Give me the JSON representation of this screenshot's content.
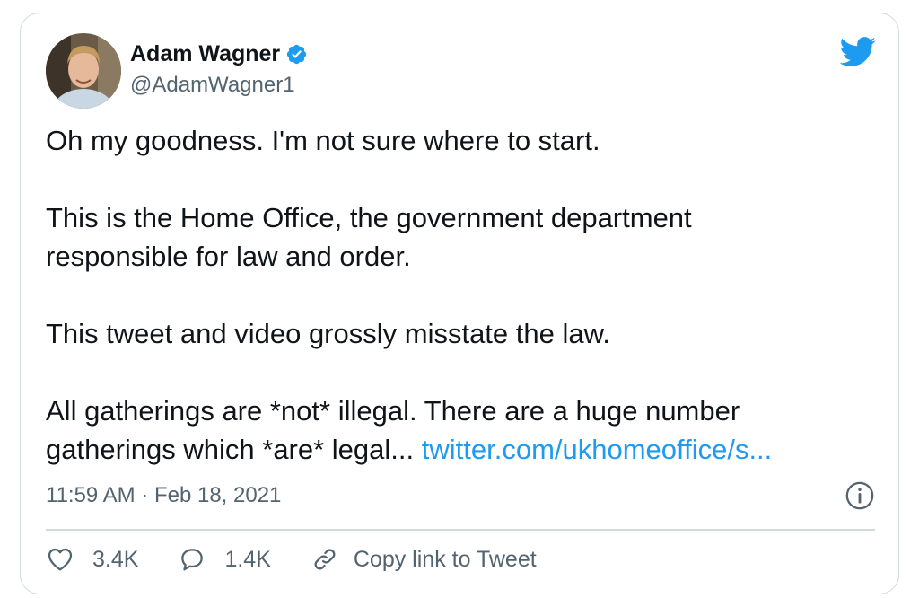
{
  "author": {
    "display_name": "Adam Wagner",
    "handle": "@AdamWagner1",
    "verified": true
  },
  "tweet": {
    "lines": [
      "Oh my goodness. I'm not sure where to start.",
      "",
      "This is the Home Office, the government department",
      "responsible for law and order.",
      "",
      "This tweet and video grossly misstate the law.",
      "",
      "All gatherings are *not* illegal. There are a huge number",
      "gatherings which *are* legal... "
    ],
    "link_text": "twitter.com/ukhomeoffice/s..."
  },
  "meta": {
    "timestamp": "11:59 AM · Feb 18, 2021"
  },
  "actions": {
    "likes": "3.4K",
    "replies": "1.4K",
    "copy_link_label": "Copy link to Tweet"
  },
  "icons": {
    "brand": "twitter-bird-icon",
    "verified": "verified-badge-icon",
    "info": "info-icon",
    "like": "heart-icon",
    "reply": "reply-bubble-icon",
    "copy": "link-icon"
  },
  "colors": {
    "brand_blue": "#1d9bf0",
    "text_primary": "#0f1419",
    "text_secondary": "#536471",
    "border": "#cfd9de"
  }
}
